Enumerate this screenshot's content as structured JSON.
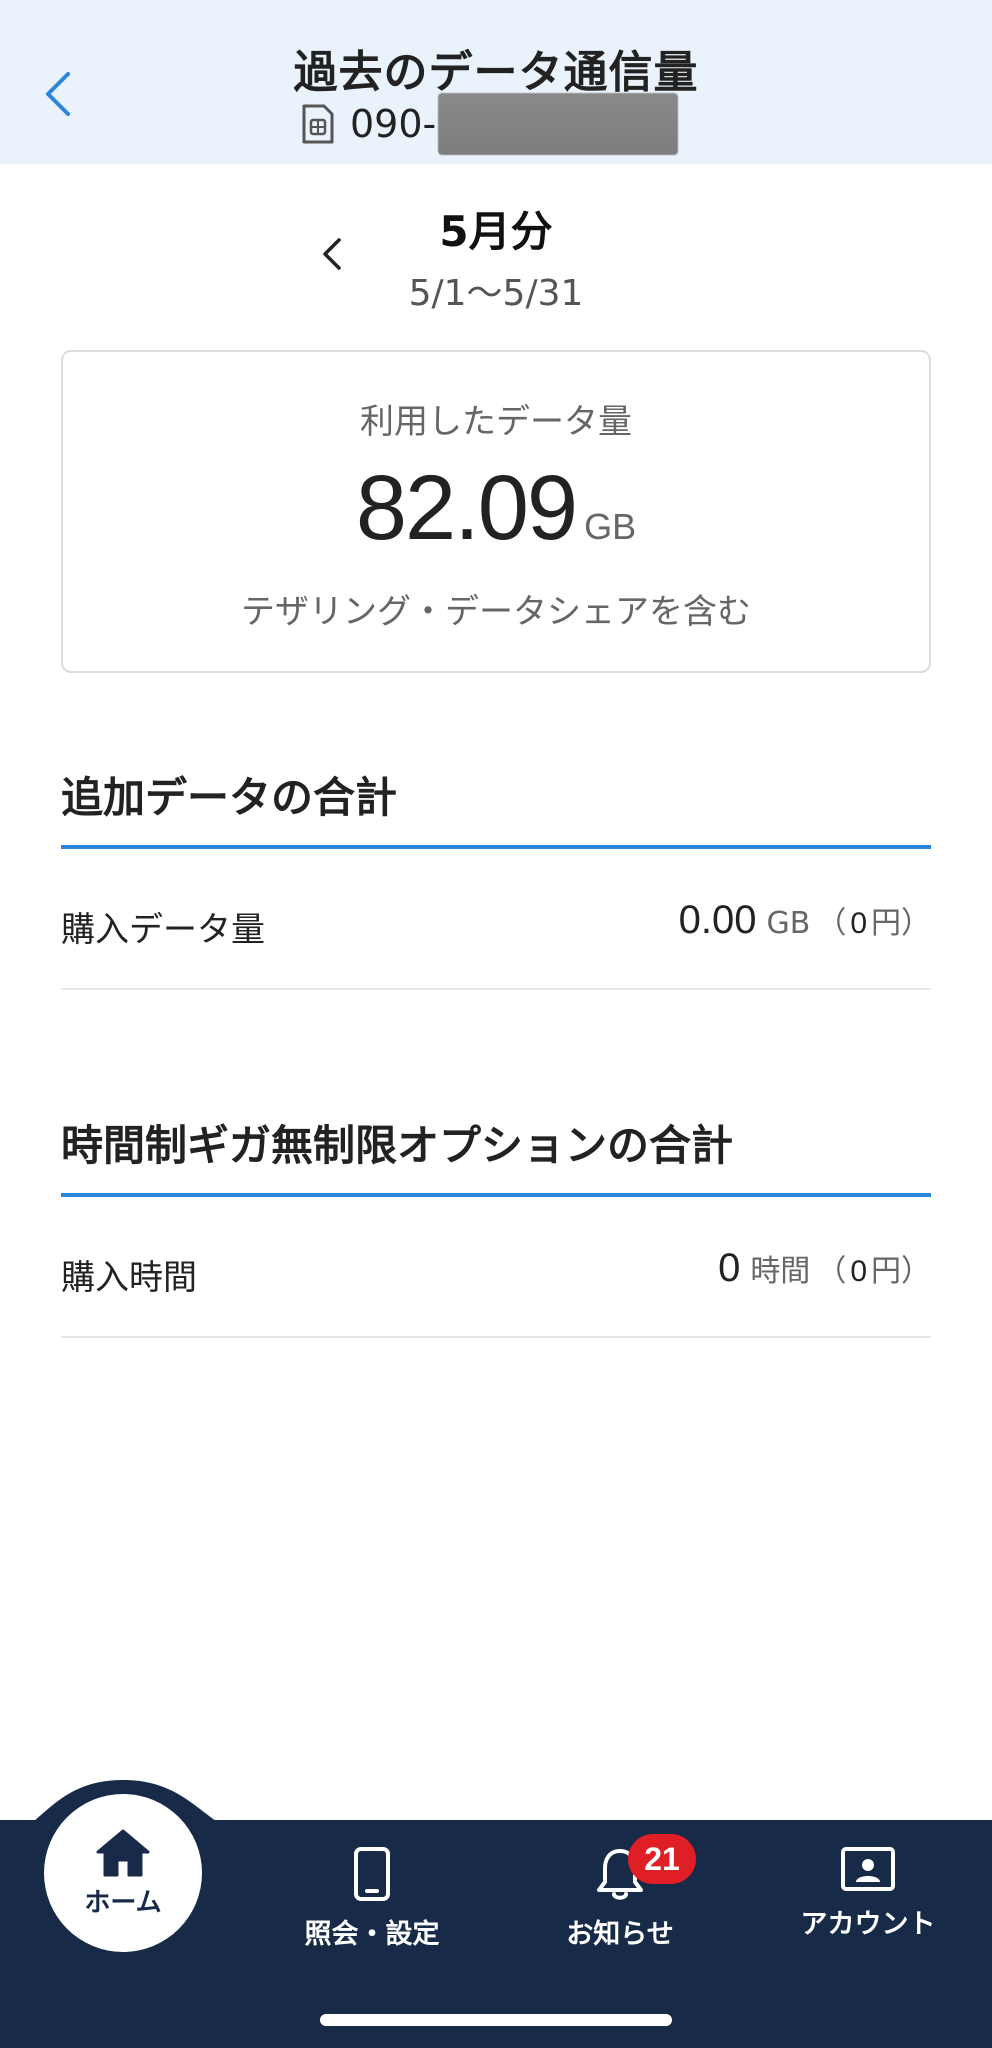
{
  "header": {
    "title": "過去のデータ通信量",
    "phone_prefix": "090-"
  },
  "period": {
    "month_label": "5月分",
    "range": "5/1〜5/31"
  },
  "usage": {
    "label": "利用したデータ量",
    "value": "82.09",
    "unit": "GB",
    "note": "テザリング・データシェアを含む"
  },
  "additional_data": {
    "title": "追加データの合計",
    "row_label": "購入データ量",
    "amount": "0.00",
    "unit": "GB",
    "paren_open": "（",
    "yen": "0",
    "yen_unit": "円）"
  },
  "unlimited_option": {
    "title": "時間制ギガ無制限オプションの合計",
    "row_label": "購入時間",
    "amount": "0",
    "unit": "時間",
    "paren_open": "（",
    "yen": "0",
    "yen_unit": "円）"
  },
  "nav": {
    "home": "ホーム",
    "settings": "照会・設定",
    "notifications": "お知らせ",
    "notifications_badge": "21",
    "account": "アカウント"
  },
  "colors": {
    "header_bg": "#eaf3fc",
    "accent": "#2b86d9",
    "nav_bg": "#172a47",
    "badge": "#e01e26"
  },
  "icons": {
    "back": "chevron-left-icon",
    "sim": "sim-card-icon",
    "home": "home-icon",
    "settings": "smartphone-icon",
    "notifications": "bell-icon",
    "account": "id-card-icon"
  }
}
